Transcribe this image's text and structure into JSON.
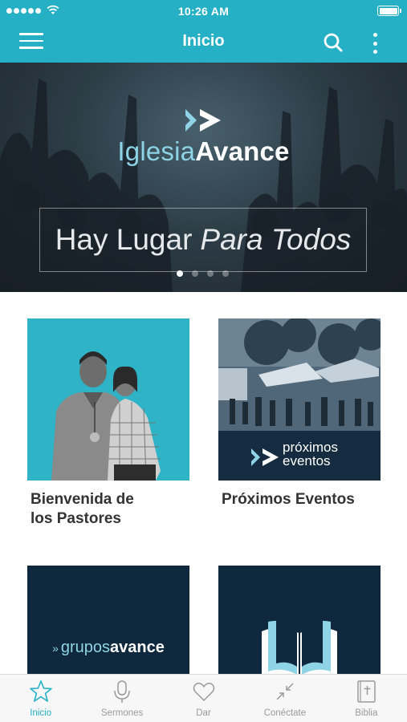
{
  "status_bar": {
    "time": "10:26 AM"
  },
  "header": {
    "title": "Inicio"
  },
  "hero": {
    "brand_light": "Iglesia",
    "brand_bold": "Avance",
    "tagline_regular": "Hay Lugar",
    "tagline_italic": "Para Todos",
    "carousel": {
      "count": 4,
      "active_index": 0
    }
  },
  "cards": [
    {
      "label": "Bienvenida de los Pastores"
    },
    {
      "label": "Próximos Eventos",
      "overlay_line1": "próximos",
      "overlay_line2": "eventos"
    },
    {
      "label": "",
      "overlay_light": "grupos",
      "overlay_bold": "avance"
    },
    {
      "label": ""
    }
  ],
  "tabs": [
    {
      "label": "Inicio",
      "icon": "star-icon",
      "active": true
    },
    {
      "label": "Sermones",
      "icon": "microphone-icon",
      "active": false
    },
    {
      "label": "Dar",
      "icon": "heart-icon",
      "active": false
    },
    {
      "label": "Conéctate",
      "icon": "arrows-in-icon",
      "active": false
    },
    {
      "label": "Biblia",
      "icon": "bible-icon",
      "active": false
    }
  ],
  "colors": {
    "accent": "#25b0c6",
    "navy": "#10283d",
    "light_blue": "#8ed4e6",
    "tab_inactive": "#9a9a9a"
  }
}
